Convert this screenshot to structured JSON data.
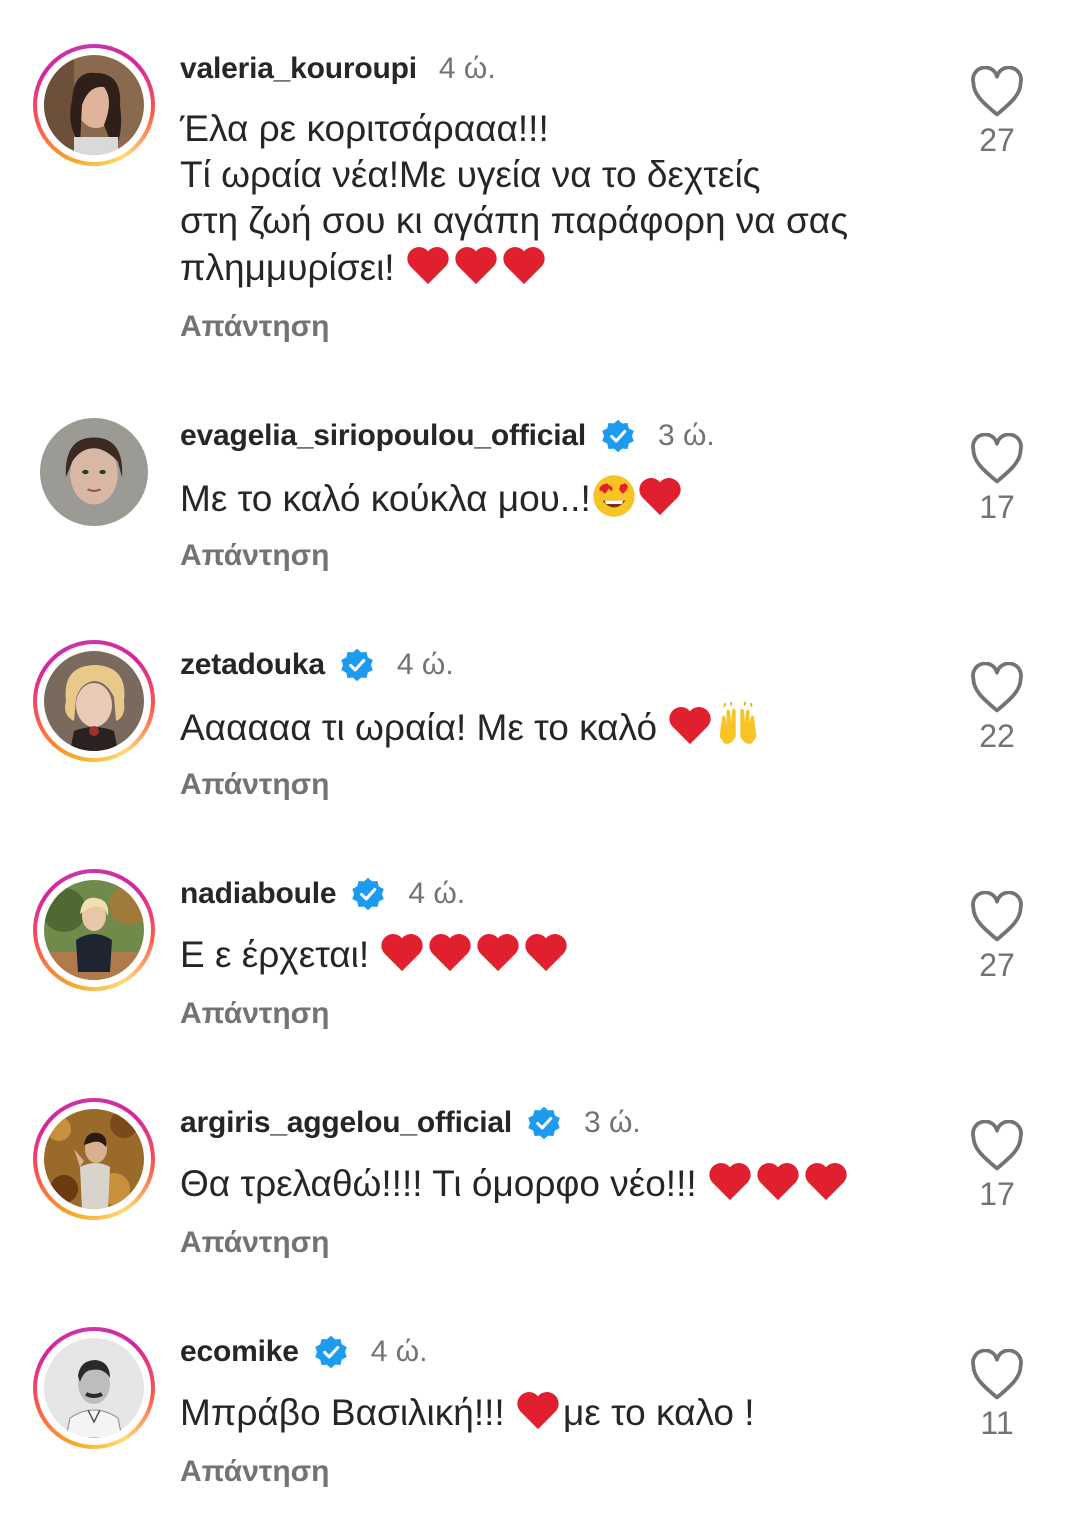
{
  "reply_label": "Απάντηση",
  "colors": {
    "verified": "#1d9bf0",
    "heart_emoji": "#e0202f",
    "muted": "#737373",
    "text": "#262626"
  },
  "comments": [
    {
      "username": "valeria_kouroupi",
      "verified": false,
      "time": "4 ώ.",
      "lines": [
        "Έλα ρε κοριτσάρααα!!!",
        "Τί ωραία νέα!Με υγεία να το δεχτείς",
        "στη ζωή σου κι αγάπη παράφορη να σας",
        "πλημμυρίσει! "
      ],
      "emojis": [
        "red-heart",
        "red-heart",
        "red-heart"
      ],
      "likes": "27"
    },
    {
      "username": "evagelia_siriopoulou_official",
      "verified": true,
      "time": "3 ώ.",
      "text": "Με το καλό κούκλα μου..!",
      "emojis": [
        "heart-eyes",
        "red-heart"
      ],
      "likes": "17"
    },
    {
      "username": "zetadouka",
      "verified": true,
      "time": "4 ώ.",
      "text": "Αααααα τι ωραία! Με το καλό ",
      "emojis": [
        "red-heart",
        "raising-hands"
      ],
      "likes": "22"
    },
    {
      "username": "nadiaboule",
      "verified": true,
      "time": "4 ώ.",
      "text": "Ε ε έρχεται! ",
      "emojis": [
        "red-heart",
        "red-heart",
        "red-heart",
        "red-heart"
      ],
      "likes": "27"
    },
    {
      "username": "argiris_aggelou_official",
      "verified": true,
      "time": "3 ώ.",
      "text": "Θα τρελαθώ!!!! Τι όμορφο νέο!!! ",
      "emojis": [
        "red-heart",
        "red-heart",
        "red-heart"
      ],
      "likes": "17"
    },
    {
      "username": "ecomike",
      "verified": true,
      "time": "4 ώ.",
      "text_before": "Μπράβο Βασιλική!!! ",
      "emojis": [
        "red-heart"
      ],
      "text_after": "με το καλο !",
      "likes": "11"
    }
  ]
}
